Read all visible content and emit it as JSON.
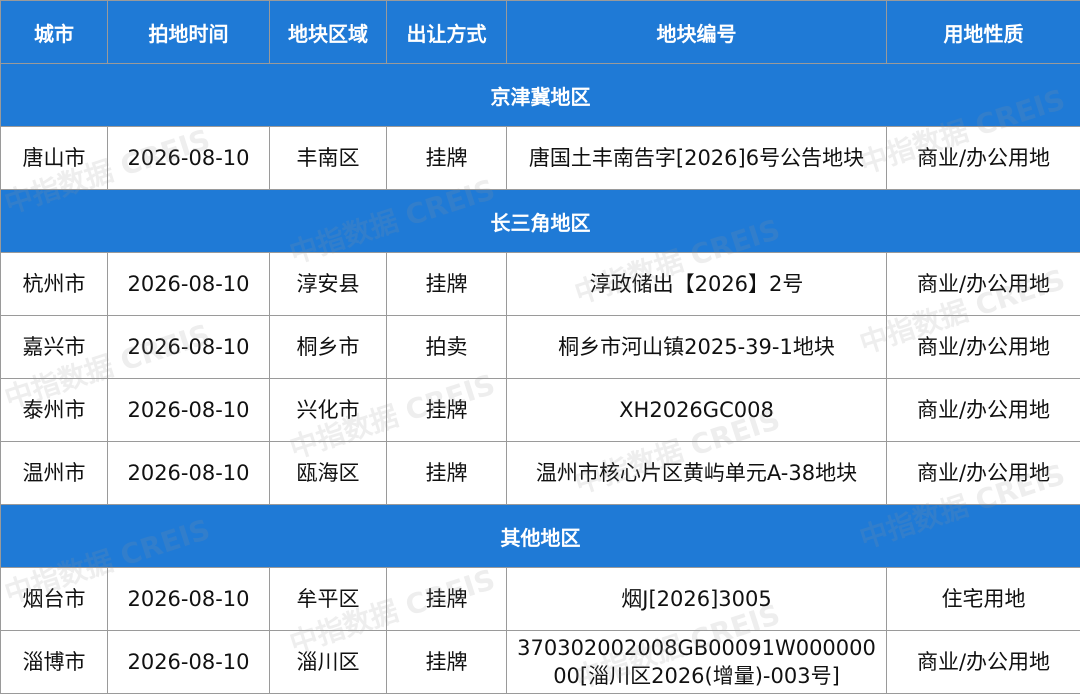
{
  "table": {
    "headers": [
      "城市",
      "拍地时间",
      "地块区域",
      "出让方式",
      "地块编号",
      "用地性质"
    ],
    "sections": [
      {
        "region": "京津冀地区",
        "rows": [
          [
            "唐山市",
            "2026-08-10",
            "丰南区",
            "挂牌",
            "唐国土丰南告字[2026]6号公告地块",
            "商业/办公用地"
          ]
        ]
      },
      {
        "region": "长三角地区",
        "rows": [
          [
            "杭州市",
            "2026-08-10",
            "淳安县",
            "挂牌",
            "淳政储出【2026】2号",
            "商业/办公用地"
          ],
          [
            "嘉兴市",
            "2026-08-10",
            "桐乡市",
            "拍卖",
            "桐乡市河山镇2025-39-1地块",
            "商业/办公用地"
          ],
          [
            "泰州市",
            "2026-08-10",
            "兴化市",
            "挂牌",
            "XH2026GC008",
            "商业/办公用地"
          ],
          [
            "温州市",
            "2026-08-10",
            "瓯海区",
            "挂牌",
            "温州市核心片区黄屿单元A-38地块",
            "商业/办公用地"
          ]
        ]
      },
      {
        "region": "其他地区",
        "rows": [
          [
            "烟台市",
            "2026-08-10",
            "牟平区",
            "挂牌",
            "烟J[2026]3005",
            "住宅用地"
          ],
          [
            "淄博市",
            "2026-08-10",
            "淄川区",
            "挂牌",
            "370302002008GB00091W00000000[淄川区2026(增量)-003号]",
            "商业/办公用地"
          ]
        ]
      }
    ]
  },
  "watermark": "中指数据 CREIS",
  "colors": {
    "header_bg": "#1f7ad6",
    "header_text": "#ffffff",
    "border": "#9a9a9a"
  }
}
